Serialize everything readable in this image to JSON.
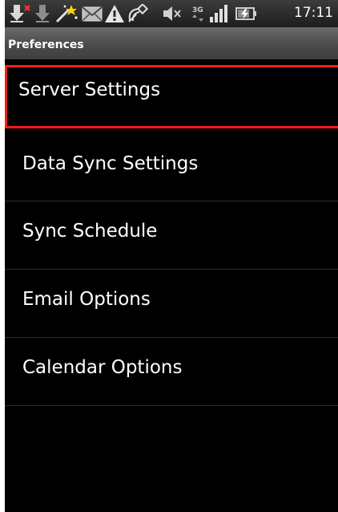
{
  "status_bar": {
    "icons": [
      "download-error-icon",
      "download-icon",
      "magic-wand-icon",
      "email-icon",
      "warning-icon",
      "satellite-icon",
      "speaker-muted-icon",
      "3g-icon",
      "signal-bars-icon",
      "battery-charging-icon"
    ],
    "time": "17:11"
  },
  "title_bar": {
    "title": "Preferences"
  },
  "menu": {
    "items": [
      {
        "label": "Server Settings"
      },
      {
        "label": "Data Sync Settings"
      },
      {
        "label": "Sync Schedule"
      },
      {
        "label": "Email Options"
      },
      {
        "label": "Calendar Options"
      }
    ]
  },
  "colors": {
    "background": "#000000",
    "highlight": "#ff1a1a",
    "text": "#ffffff"
  }
}
